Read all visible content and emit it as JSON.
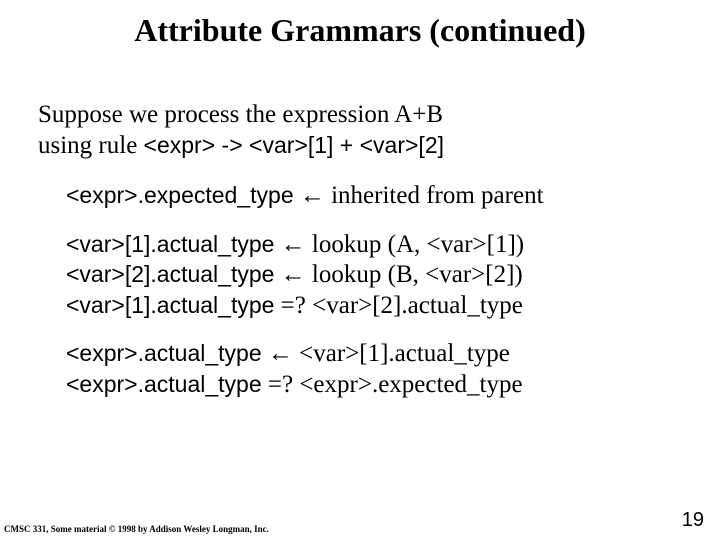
{
  "title": "Attribute Grammars (continued)",
  "intro": {
    "line1": "Suppose we process the expression A+B",
    "line2_a": "using rule ",
    "line2_b": "<expr> -> <var>[1] + <var>[2]"
  },
  "block1": {
    "l1_a": "<expr>.expected_type",
    "l1_b": " ← inherited from parent"
  },
  "block2": {
    "l1_a": "<var>[1].actual_type",
    "l1_b": " ← lookup (A, <var>[1])",
    "l2_a": "<var>[2].actual_type",
    "l2_b": " ← lookup (B, <var>[2])",
    "l3_a": "<var>[1].actual_type",
    "l3_b": " =? <var>[2].actual_type"
  },
  "block3": {
    "l1_a": "<expr>.actual_type",
    "l1_b": " ← <var>[1].actual_type",
    "l2_a": "<expr>.actual_type",
    "l2_b": " =? <expr>.expected_type"
  },
  "footer": "CMSC 331, Some material © 1998 by Addison Wesley Longman, Inc.",
  "pagenum": "19"
}
